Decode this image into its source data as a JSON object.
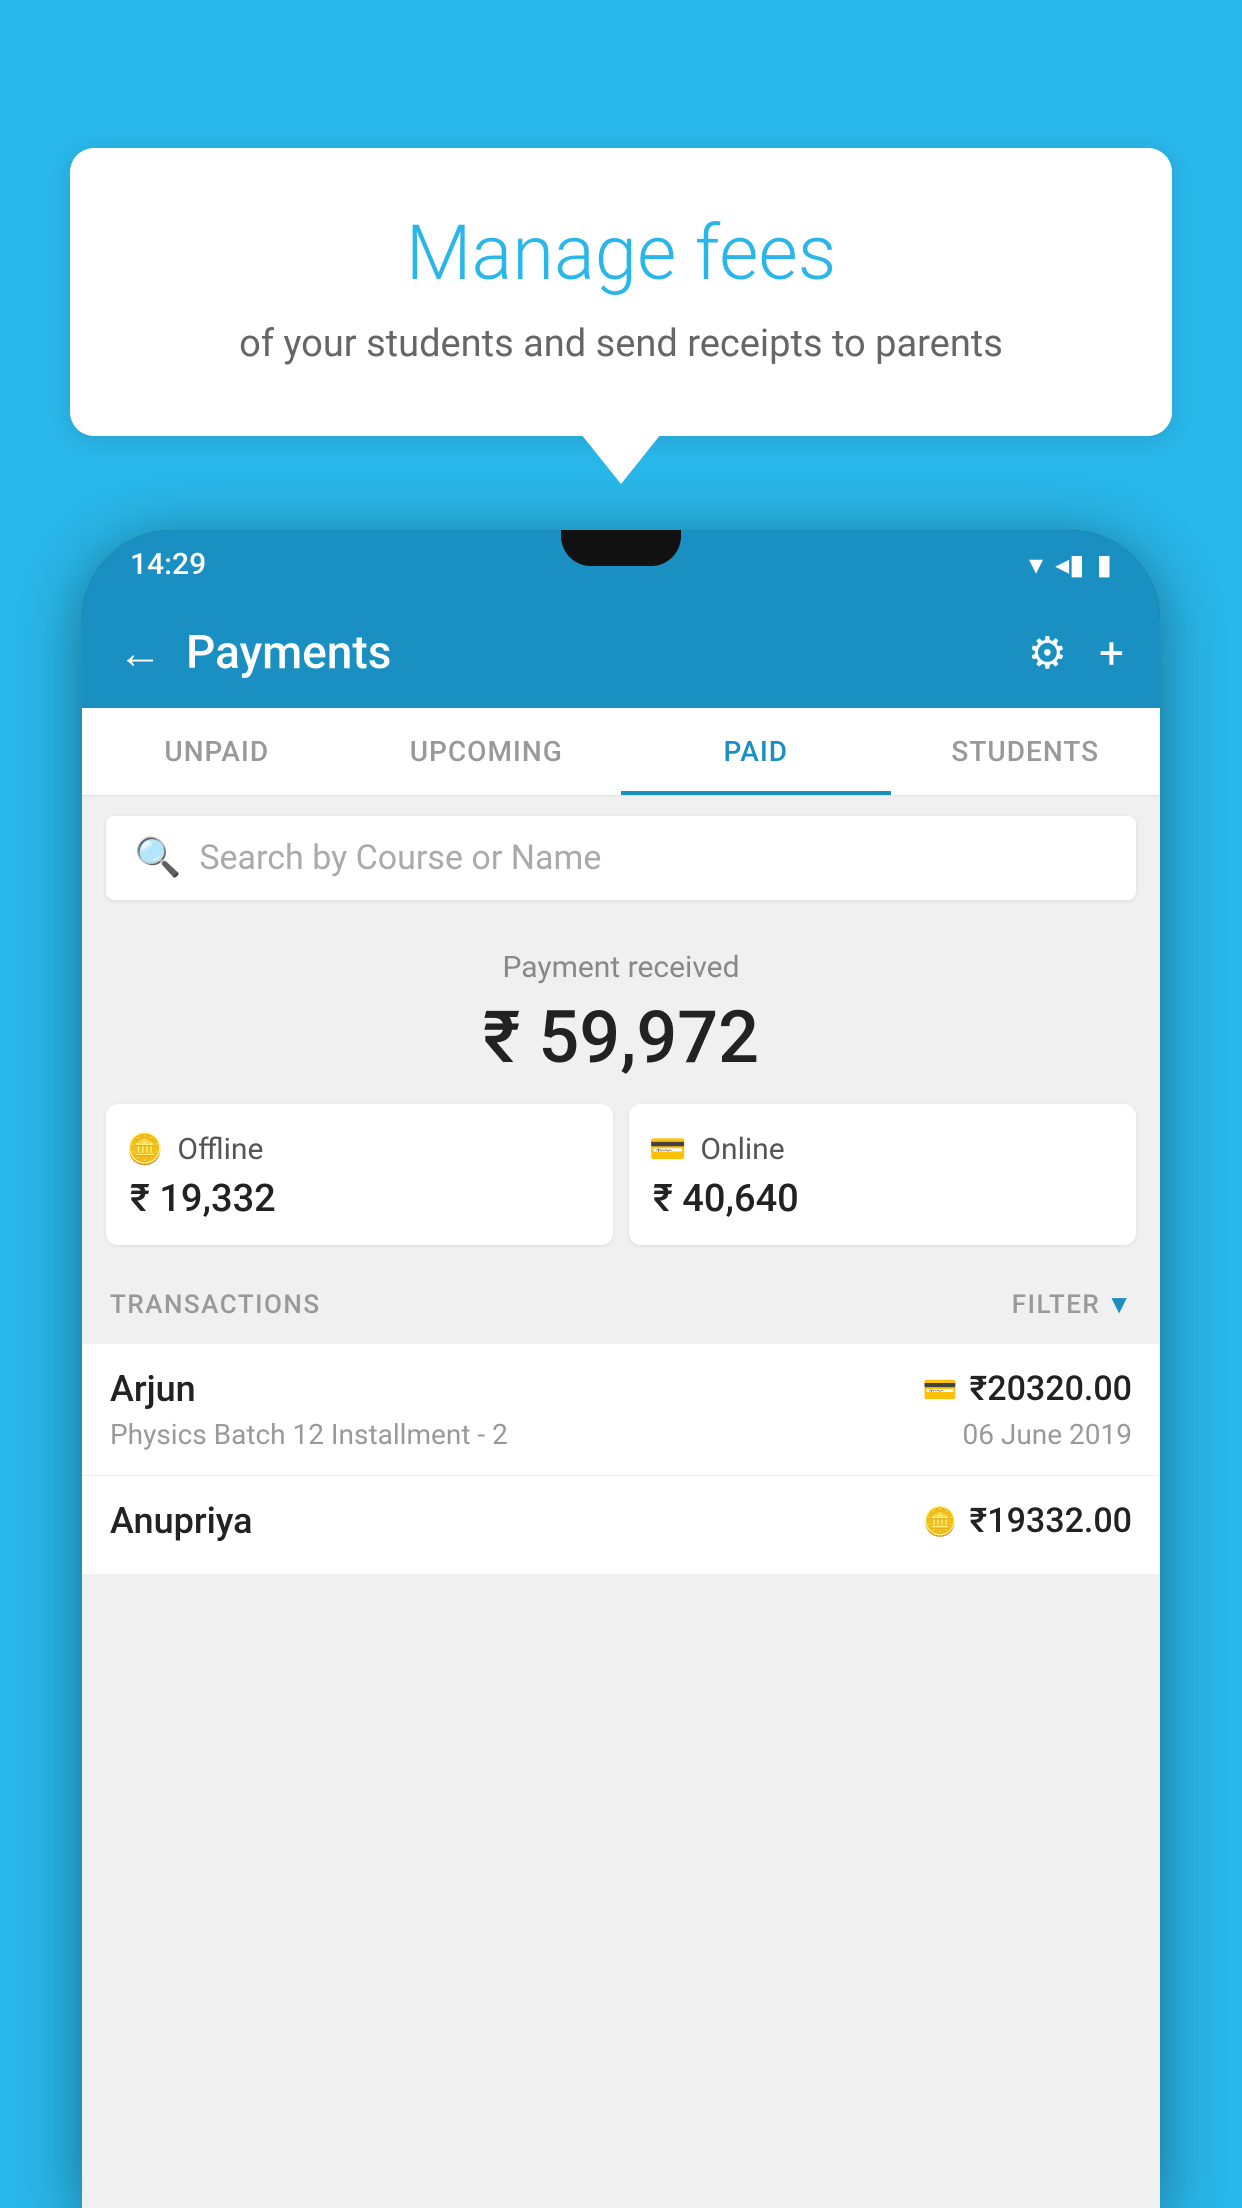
{
  "background_color": "#29b6e8",
  "bubble": {
    "title": "Manage fees",
    "subtitle": "of your students and send receipts to parents"
  },
  "status_bar": {
    "time": "14:29",
    "icons": [
      "▾◂▮"
    ]
  },
  "app_bar": {
    "title": "Payments",
    "back_icon": "←",
    "settings_icon": "⚙",
    "add_icon": "+"
  },
  "tabs": [
    {
      "label": "UNPAID",
      "active": false
    },
    {
      "label": "UPCOMING",
      "active": false
    },
    {
      "label": "PAID",
      "active": true
    },
    {
      "label": "STUDENTS",
      "active": false
    }
  ],
  "search": {
    "placeholder": "Search by Course or Name"
  },
  "payment": {
    "label": "Payment received",
    "total": "₹ 59,972",
    "offline": {
      "label": "Offline",
      "amount": "₹ 19,332"
    },
    "online": {
      "label": "Online",
      "amount": "₹ 40,640"
    }
  },
  "transactions": {
    "header_label": "TRANSACTIONS",
    "filter_label": "FILTER",
    "rows": [
      {
        "name": "Arjun",
        "description": "Physics Batch 12 Installment - 2",
        "amount": "₹20320.00",
        "date": "06 June 2019",
        "type": "online"
      },
      {
        "name": "Anupriya",
        "description": "",
        "amount": "₹19332.00",
        "date": "",
        "type": "offline"
      }
    ]
  }
}
